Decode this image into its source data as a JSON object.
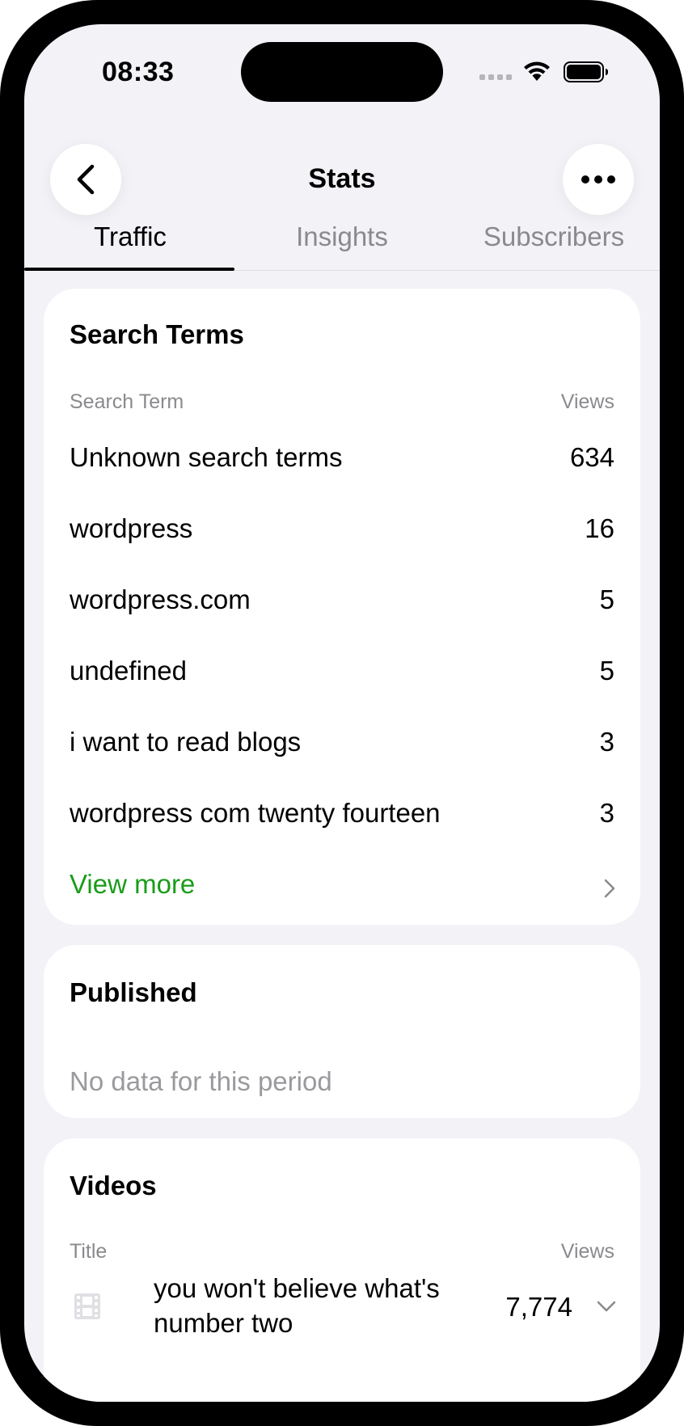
{
  "status_bar": {
    "time": "08:33"
  },
  "header": {
    "title": "Stats",
    "back_icon": "chevron-left-icon",
    "more_icon": "ellipsis-icon"
  },
  "tabs": [
    {
      "label": "Traffic",
      "active": true
    },
    {
      "label": "Insights",
      "active": false
    },
    {
      "label": "Subscribers",
      "active": false
    }
  ],
  "search_terms": {
    "title": "Search Terms",
    "col_term": "Search Term",
    "col_views": "Views",
    "rows": [
      {
        "term": "Unknown search terms",
        "views": "634"
      },
      {
        "term": "wordpress",
        "views": "16"
      },
      {
        "term": "wordpress.com",
        "views": "5"
      },
      {
        "term": "undefined",
        "views": "5"
      },
      {
        "term": "i want to read blogs",
        "views": "3"
      },
      {
        "term": "wordpress com twenty fourteen",
        "views": "3"
      }
    ],
    "view_more": "View more"
  },
  "published": {
    "title": "Published",
    "empty": "No data for this period"
  },
  "videos": {
    "title": "Videos",
    "col_title": "Title",
    "col_views": "Views",
    "rows": [
      {
        "title_line1": "you won't believe what's",
        "title_line2": "number two",
        "views": "7,774",
        "icon": "video-film-icon"
      }
    ]
  },
  "colors": {
    "accent": "#1a9c1a",
    "background": "#f2f2f7",
    "secondary_text": "#8a8a8e"
  }
}
